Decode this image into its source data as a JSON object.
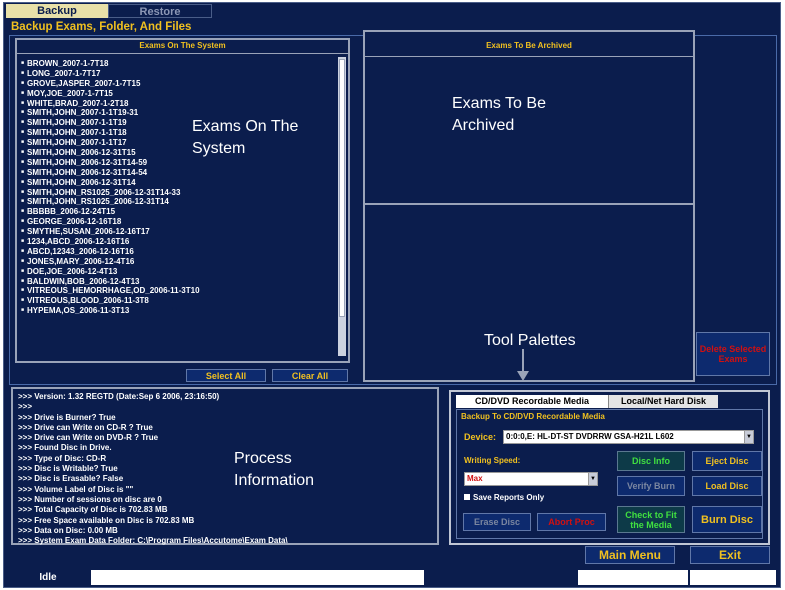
{
  "tabs": {
    "backup": "Backup",
    "restore": "Restore"
  },
  "section_title": "Backup Exams, Folder, And Files",
  "exams_on_system": {
    "title": "Exams On The System",
    "items": [
      "BROWN_2007-1-7T18",
      "LONG_2007-1-7T17",
      "GROVE,JASPER_2007-1-7T15",
      "MOY,JOE_2007-1-7T15",
      "WHITE,BRAD_2007-1-2T18",
      "SMITH,JOHN_2007-1-1T19-31",
      "SMITH,JOHN_2007-1-1T19",
      "SMITH,JOHN_2007-1-1T18",
      "SMITH,JOHN_2007-1-1T17",
      "SMITH,JOHN_2006-12-31T15",
      "SMITH,JOHN_2006-12-31T14-59",
      "SMITH,JOHN_2006-12-31T14-54",
      "SMITH,JOHN_2006-12-31T14",
      "SMITH,JOHN_RS1025_2006-12-31T14-33",
      "SMITH,JOHN_RS1025_2006-12-31T14",
      "BBBBB_2006-12-24T15",
      "GEORGE_2006-12-16T18",
      "SMYTHE,SUSAN_2006-12-16T17",
      "1234,ABCD_2006-12-16T16",
      "ABCD,12343_2006-12-16T16",
      "JONES,MARY_2006-12-4T16",
      "DOE,JOE_2006-12-4T13",
      "BALDWIN,BOB_2006-12-4T13",
      "VITREOUS_HEMORRHAGE,OD_2006-11-3T10",
      "VITREOUS,BLOOD_2006-11-3T8",
      "HYPEMA,OS_2006-11-3T13"
    ],
    "select_all": "Select All",
    "clear_all": "Clear All"
  },
  "exams_to_archive": {
    "title": "Exams To Be Archived"
  },
  "delete_button": "Delete Selected Exams",
  "overlays": {
    "exams_on_system_line1": "Exams On The",
    "exams_on_system_line2": "System",
    "archived_line1": "Exams To Be",
    "archived_line2": "Archived",
    "tool_palettes": "Tool Palettes",
    "process_line1": "Process",
    "process_line2": "Information"
  },
  "process_lines": [
    ">>> Version: 1.32 REGTD (Date:Sep  6 2006, 23:16:50)",
    ">>>",
    ">>> Drive is Burner? True",
    ">>> Drive can Write on CD-R ? True",
    ">>> Drive can Write on DVD-R ? True",
    ">>> Found Disc in Drive.",
    ">>> Type of Disc: CD-R",
    ">>> Disc is Writable? True",
    ">>> Disc is Erasable? False",
    ">>> Volume Label of Disc is \"\"",
    ">>> Number of sessions on disc are 0",
    ">>> Total Capacity of Disc is 702.83 MB",
    ">>> Free Space available on Disc is 702.83 MB",
    ">>> Data on Disc: 0.00 MB",
    ">>> System Exam Data Folder: C:\\Program Files\\Accutome\\Exam Data\\"
  ],
  "tool_tabs": {
    "cd_dvd": "CD/DVD  Recordable Media",
    "local": "Local/Net Hard Disk"
  },
  "burn_panel": {
    "subtitle": "Backup To CD/DVD Recordable Media",
    "device_label": "Device:",
    "device_value": "0:0:0,E: HL-DT-ST DVDRRW GSA-H21L  L602",
    "writing_speed_label": "Writing Speed:",
    "writing_speed_value": "Max",
    "save_reports": "Save Reports Only",
    "disc_info": "Disc Info",
    "eject_disc": "Eject Disc",
    "verify_burn": "Verify Burn",
    "load_disc": "Load Disc",
    "erase_disc": "Erase Disc",
    "abort_proc": "Abort Proc",
    "check_to_fit": "Check to Fit the Media",
    "burn_disc": "Burn Disc"
  },
  "main_menu": "Main Menu",
  "exit": "Exit",
  "status": "Idle"
}
